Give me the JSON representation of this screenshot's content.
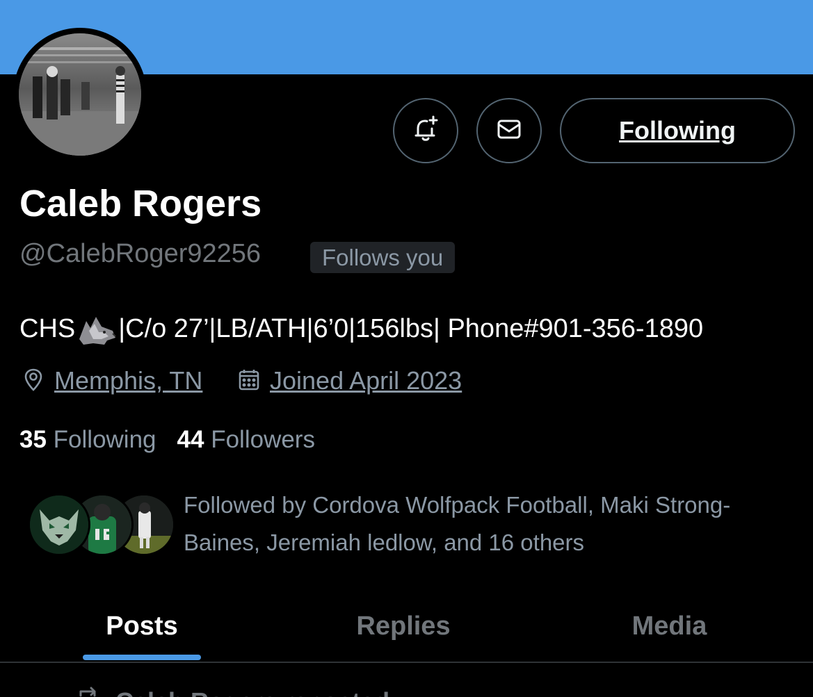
{
  "colors": {
    "banner": "#4a99e6",
    "background": "#000000",
    "accent": "#4a99e6",
    "muted_text": "#71767b",
    "border": "#536471"
  },
  "profile": {
    "display_name": "Caleb Rogers",
    "handle": "@CalebRoger92256",
    "follows_you_badge": "Follows you",
    "bio_prefix": "CHS",
    "bio_emoji": "wolf-emoji",
    "bio_suffix": "|C/o 27’|LB/ATH|6’0|156lbs| Phone#901-356-1890",
    "location": "Memphis, TN",
    "joined": "Joined April 2023"
  },
  "actions": {
    "notify_icon": "bell-plus-icon",
    "message_icon": "envelope-icon",
    "follow_label": "Following"
  },
  "stats": {
    "following_count": "35",
    "following_label": "Following",
    "followers_count": "44",
    "followers_label": "Followers"
  },
  "followed_by": {
    "text": "Followed by Cordova Wolfpack Football, Maki Strong-Baines, Jeremiah ledlow, and 16 others"
  },
  "tabs": [
    {
      "label": "Posts",
      "active": true
    },
    {
      "label": "Replies",
      "active": false
    },
    {
      "label": "Media",
      "active": false
    }
  ],
  "feed_peek": {
    "icon": "repost-icon",
    "text": "Caleb Rogers reposted"
  }
}
